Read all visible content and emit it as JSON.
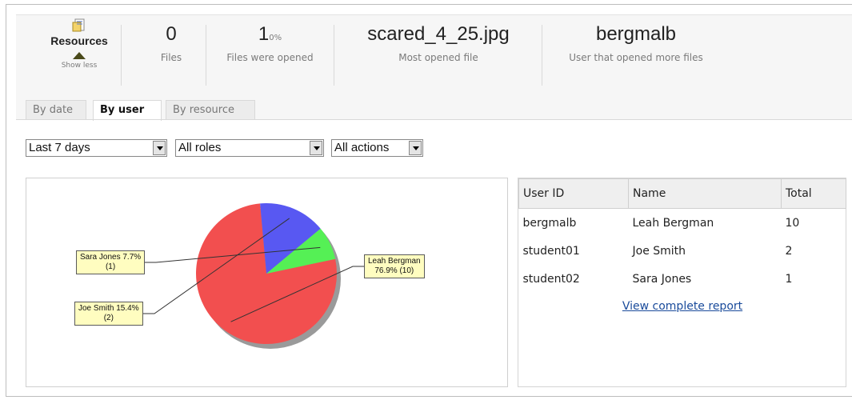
{
  "resources": {
    "title": "Resources",
    "toggle_label": "Show less"
  },
  "stats": [
    {
      "value": "0",
      "label": "Files"
    },
    {
      "value": "1",
      "suffix": "0%",
      "label": "Files were opened"
    },
    {
      "value": "scared_4_25.jpg",
      "label": "Most opened file"
    },
    {
      "value": "bergmalb",
      "label": "User that opened more files"
    }
  ],
  "tabs": [
    {
      "label": "By date",
      "active": false
    },
    {
      "label": "By user",
      "active": true
    },
    {
      "label": "By resource",
      "active": false
    }
  ],
  "filters": {
    "period": "Last 7 days",
    "roles": "All roles",
    "actions": "All actions"
  },
  "chart_data": {
    "type": "pie",
    "slices": [
      {
        "label": "Leah Bergman",
        "percent": 76.9,
        "count": 10,
        "color": "#f24f4f",
        "text": "Leah Bergman",
        "text2": "76.9% (10)"
      },
      {
        "label": "Joe Smith",
        "percent": 15.4,
        "count": 2,
        "color": "#5858f2",
        "text": "Joe Smith 15.4%",
        "text2": "(2)"
      },
      {
        "label": "Sara Jones",
        "percent": 7.7,
        "count": 1,
        "color": "#55f055",
        "text": "Sara Jones 7.7%",
        "text2": "(1)"
      }
    ]
  },
  "report": {
    "headers": [
      "User ID",
      "Name",
      "Total"
    ],
    "rows": [
      [
        "bergmalb",
        "Leah Bergman",
        "10"
      ],
      [
        "student01",
        "Joe Smith",
        "2"
      ],
      [
        "student02",
        "Sara Jones",
        "1"
      ]
    ],
    "link": "View complete report"
  }
}
